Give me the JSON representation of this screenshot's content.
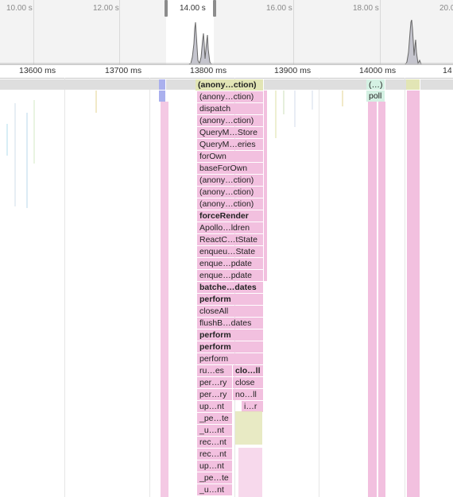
{
  "overview": {
    "time_labels": [
      "10.00 s",
      "12.00 s",
      "14.00 s",
      "16.00 s",
      "18.00 s",
      "20.0"
    ]
  },
  "ruler": {
    "labels": [
      "13600 ms",
      "13700 ms",
      "13800 ms",
      "13900 ms",
      "14000 ms",
      "14"
    ]
  },
  "flame": {
    "top_frame": "(anony…ction)",
    "main_stack": [
      "(anony…ction)",
      "dispatch",
      "(anony…ction)",
      "QueryM…Store",
      "QueryM…eries",
      "forOwn",
      "baseForOwn",
      "(anony…ction)",
      "(anony…ction)",
      "(anony…ction)",
      "forceRender",
      "Apollo…ldren",
      "ReactC…tState",
      "enqueu…State",
      "enque…pdate",
      "enque…pdate",
      "batche…dates",
      "perform",
      "closeAll",
      "flushB…dates",
      "perform",
      "perform",
      "perform"
    ],
    "bold_rows": [
      11,
      17,
      18,
      21,
      22
    ],
    "left_branch": [
      "ru…es",
      "per…ry",
      "per…ry",
      "up…nt",
      "_pe…te",
      "_u…nt",
      "rec…nt",
      "rec…nt",
      "up…nt",
      "_pe…te",
      "_u…nt"
    ],
    "right_branch": [
      "clo…ll",
      "close",
      "no…ll",
      "i…r"
    ],
    "side_top": "(…)",
    "side_second": "poll"
  },
  "colors": {
    "js_frame": "#f2c0df",
    "highlight": "#e2e5b5",
    "timer": "#d4f1e3",
    "idle": "#dedede",
    "event": "#aab0ee"
  }
}
